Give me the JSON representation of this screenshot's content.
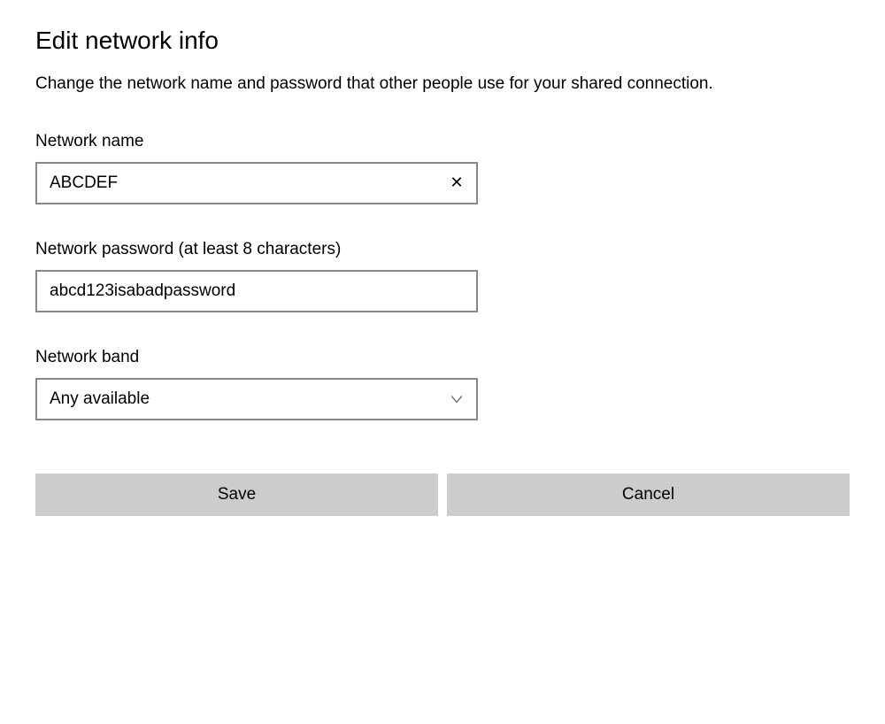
{
  "dialog": {
    "title": "Edit network info",
    "description": "Change the network name and password that other people use for your shared connection."
  },
  "fields": {
    "network_name": {
      "label": "Network name",
      "value": "ABCDEF"
    },
    "network_password": {
      "label": "Network password (at least 8 characters)",
      "value": "abcd123isabadpassword"
    },
    "network_band": {
      "label": "Network band",
      "value": "Any available"
    }
  },
  "buttons": {
    "save": "Save",
    "cancel": "Cancel"
  }
}
